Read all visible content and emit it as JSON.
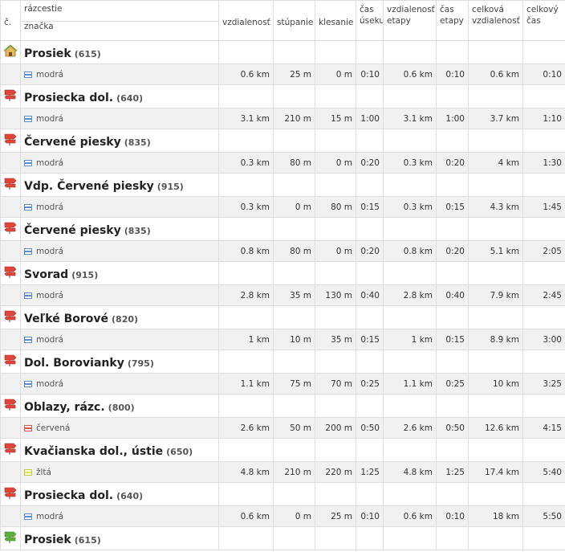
{
  "header": {
    "num": "č.",
    "razcestie": "rázcestie",
    "znacka": "značka",
    "vzdialenost": "vzdialenosť",
    "stupanie": "stúpanie",
    "klesanie": "klesanie",
    "cas_useku": "čas úseku",
    "vzdialenost_etapy": "vzdialenosť etapy",
    "cas_etapy": "čas etapy",
    "celkova_vzdialenost": "celková vzdialenosť",
    "celkovy_cas": "celkový čas"
  },
  "nodes": [
    {
      "name": "Prosiek",
      "alt": "(615)",
      "icon": "house-start-icon"
    },
    {
      "name": "Prosiecka dol.",
      "alt": "(640)",
      "icon": "signpost-icon"
    },
    {
      "name": "Červené piesky",
      "alt": "(835)",
      "icon": "signpost-icon"
    },
    {
      "name": "Vdp. Červené piesky",
      "alt": "(915)",
      "icon": "signpost-icon"
    },
    {
      "name": "Červené piesky",
      "alt": "(835)",
      "icon": "signpost-icon"
    },
    {
      "name": "Svorad",
      "alt": "(915)",
      "icon": "signpost-icon"
    },
    {
      "name": "Veľké Borové",
      "alt": "(820)",
      "icon": "signpost-icon"
    },
    {
      "name": "Dol. Borovianky",
      "alt": "(795)",
      "icon": "signpost-icon"
    },
    {
      "name": "Oblazy, rázc.",
      "alt": "(800)",
      "icon": "signpost-icon"
    },
    {
      "name": "Kvačianska dol., ústie",
      "alt": "(650)",
      "icon": "signpost-icon"
    },
    {
      "name": "Prosiecka dol.",
      "alt": "(640)",
      "icon": "signpost-icon"
    },
    {
      "name": "Prosiek",
      "alt": "(615)",
      "icon": "signpost-finish-icon"
    }
  ],
  "segments": [
    {
      "marker": "modrá",
      "color": "modra",
      "dist": "0.6 km",
      "up": "25 m",
      "down": "0 m",
      "time": "0:10",
      "stage_dist": "0.6 km",
      "stage_time": "0:10",
      "total_dist": "0.6 km",
      "total_time": "0:10"
    },
    {
      "marker": "modrá",
      "color": "modra",
      "dist": "3.1 km",
      "up": "210 m",
      "down": "15 m",
      "time": "1:00",
      "stage_dist": "3.1 km",
      "stage_time": "1:00",
      "total_dist": "3.7 km",
      "total_time": "1:10"
    },
    {
      "marker": "modrá",
      "color": "modra",
      "dist": "0.3 km",
      "up": "80 m",
      "down": "0 m",
      "time": "0:20",
      "stage_dist": "0.3 km",
      "stage_time": "0:20",
      "total_dist": "4 km",
      "total_time": "1:30"
    },
    {
      "marker": "modrá",
      "color": "modra",
      "dist": "0.3 km",
      "up": "0 m",
      "down": "80 m",
      "time": "0:15",
      "stage_dist": "0.3 km",
      "stage_time": "0:15",
      "total_dist": "4.3 km",
      "total_time": "1:45"
    },
    {
      "marker": "modrá",
      "color": "modra",
      "dist": "0.8 km",
      "up": "80 m",
      "down": "0 m",
      "time": "0:20",
      "stage_dist": "0.8 km",
      "stage_time": "0:20",
      "total_dist": "5.1 km",
      "total_time": "2:05"
    },
    {
      "marker": "modrá",
      "color": "modra",
      "dist": "2.8 km",
      "up": "35 m",
      "down": "130 m",
      "time": "0:40",
      "stage_dist": "2.8 km",
      "stage_time": "0:40",
      "total_dist": "7.9 km",
      "total_time": "2:45"
    },
    {
      "marker": "modrá",
      "color": "modra",
      "dist": "1 km",
      "up": "10 m",
      "down": "35 m",
      "time": "0:15",
      "stage_dist": "1 km",
      "stage_time": "0:15",
      "total_dist": "8.9 km",
      "total_time": "3:00"
    },
    {
      "marker": "modrá",
      "color": "modra",
      "dist": "1.1 km",
      "up": "75 m",
      "down": "70 m",
      "time": "0:25",
      "stage_dist": "1.1 km",
      "stage_time": "0:25",
      "total_dist": "10 km",
      "total_time": "3:25"
    },
    {
      "marker": "červená",
      "color": "cervena",
      "dist": "2.6 km",
      "up": "50 m",
      "down": "200 m",
      "time": "0:50",
      "stage_dist": "2.6 km",
      "stage_time": "0:50",
      "total_dist": "12.6 km",
      "total_time": "4:15"
    },
    {
      "marker": "žltá",
      "color": "zlta",
      "dist": "4.8 km",
      "up": "210 m",
      "down": "220 m",
      "time": "1:25",
      "stage_dist": "4.8 km",
      "stage_time": "1:25",
      "total_dist": "17.4 km",
      "total_time": "5:40"
    },
    {
      "marker": "modrá",
      "color": "modra",
      "dist": "0.6 km",
      "up": "0 m",
      "down": "25 m",
      "time": "0:10",
      "stage_dist": "0.6 km",
      "stage_time": "0:10",
      "total_dist": "18 km",
      "total_time": "5:50"
    }
  ]
}
